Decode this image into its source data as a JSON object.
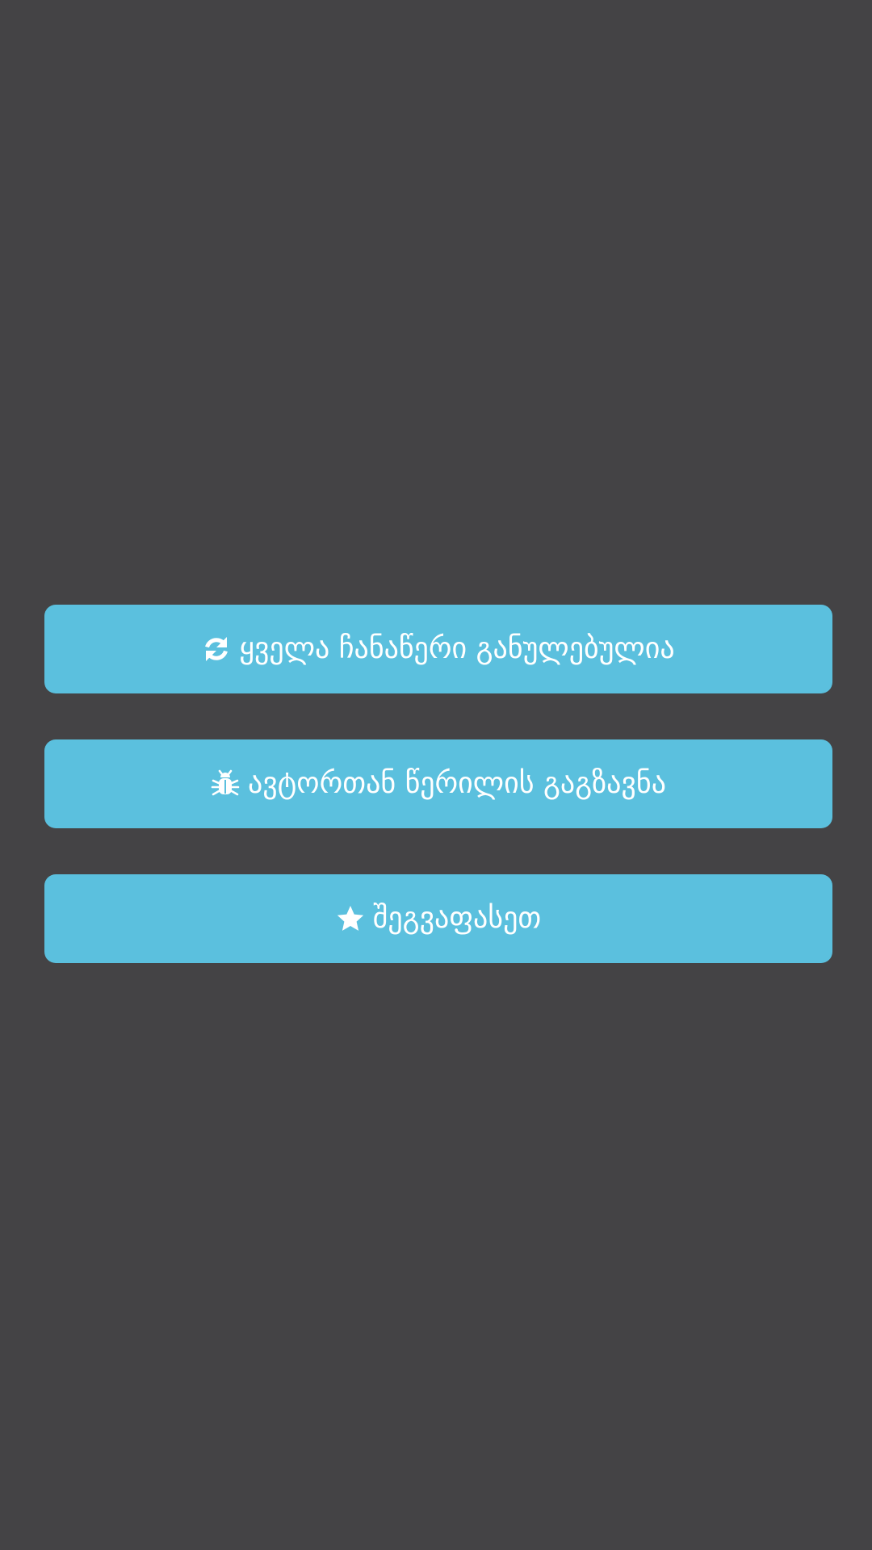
{
  "colors": {
    "background": "#444345",
    "button": "#5bc0de",
    "text": "#ffffff"
  },
  "menu": {
    "reset": {
      "label": "ყველა ჩანაწერი განულებულია",
      "icon": "refresh-icon"
    },
    "contact": {
      "label": "ავტორთან წერილის გაგზავნა",
      "icon": "bug-icon"
    },
    "rate": {
      "label": "შეგვაფასეთ",
      "icon": "star-icon"
    }
  }
}
